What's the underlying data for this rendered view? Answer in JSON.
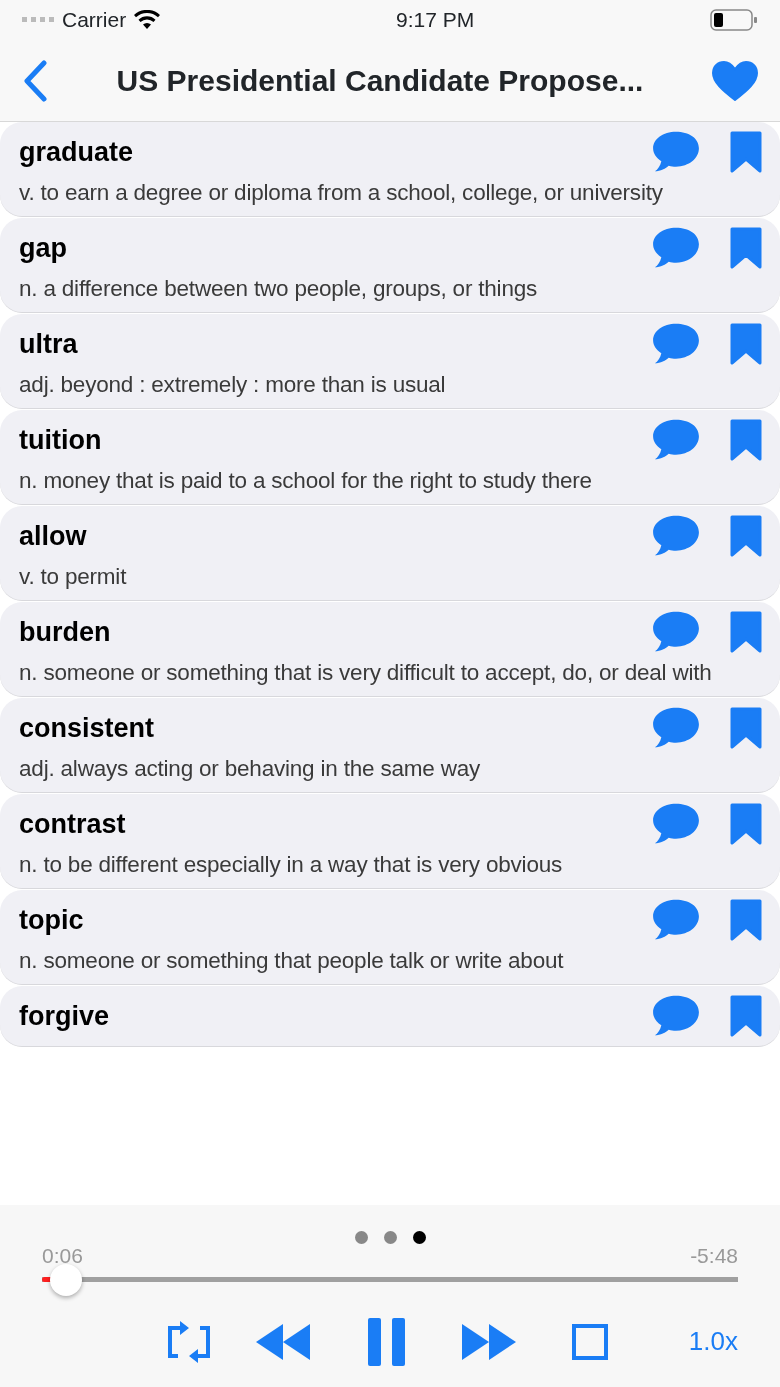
{
  "status_bar": {
    "carrier": "Carrier",
    "time": "9:17 PM"
  },
  "nav": {
    "title": "US Presidential Candidate Propose...",
    "favorite": true
  },
  "words": [
    {
      "word": "graduate",
      "definition": "v. to earn a degree or diploma from a school, college, or university",
      "bookmarked": true
    },
    {
      "word": "gap",
      "definition": "n. a difference between two people, groups, or things",
      "bookmarked": true
    },
    {
      "word": "ultra",
      "definition": "adj. beyond : extremely : more than is usual",
      "bookmarked": true
    },
    {
      "word": "tuition",
      "definition": "n. money that is paid to a school for the right to study there",
      "bookmarked": true
    },
    {
      "word": "allow",
      "definition": "v. to permit",
      "bookmarked": true
    },
    {
      "word": "burden",
      "definition": "n. someone or something that is very difficult to accept, do, or deal with",
      "bookmarked": true
    },
    {
      "word": "consistent",
      "definition": "adj. always acting or behaving in the same way",
      "bookmarked": true
    },
    {
      "word": "contrast",
      "definition": "n. to be different especially in a way that is very obvious",
      "bookmarked": true
    },
    {
      "word": "topic",
      "definition": "n. someone or something that people talk or write about",
      "bookmarked": true
    },
    {
      "word": "forgive",
      "bookmarked": true
    }
  ],
  "player": {
    "pages": [
      {
        "selected": false
      },
      {
        "selected": false
      },
      {
        "selected": true
      }
    ],
    "elapsed": "0:06",
    "remaining": "-5:48",
    "level": 0.035,
    "playing": true,
    "speed": "1.0x"
  }
}
